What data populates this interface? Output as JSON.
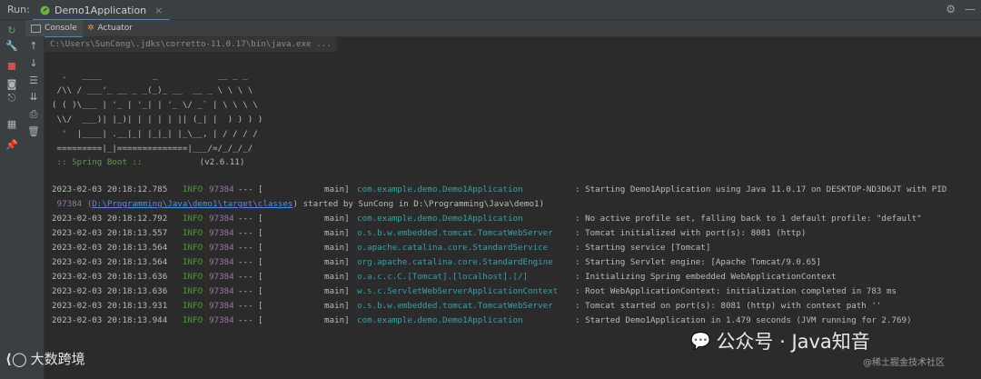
{
  "run": {
    "label": "Run:",
    "tab": "Demo1Application"
  },
  "subtabs": {
    "console": "Console",
    "actuator": "Actuator"
  },
  "command": "C:\\Users\\SunCong\\.jdks\\corretto-11.0.17\\bin\\java.exe ...",
  "banner": [
    "  .   ____          _            __ _ _",
    " /\\\\ / ___'_ __ _ _(_)_ __  __ _ \\ \\ \\ \\",
    "( ( )\\___ | '_ | '_| | '_ \\/ _` | \\ \\ \\ \\",
    " \\\\/  ___)| |_)| | | | | || (_| |  ) ) ) )",
    "  '  |____| .__|_| |_|_| |_\\__, | / / / /",
    " =========|_|==============|___/=/_/_/_/"
  ],
  "spring_boot": {
    "label": " :: Spring Boot ::",
    "version": "(v2.6.11)"
  },
  "log_lines": [
    {
      "ts": "2023-02-03 20:18:12.785",
      "level": "INFO",
      "pid": "97384",
      "sep": "--- [",
      "thread": "main]",
      "logger": "com.example.demo.Demo1Application",
      "message": ": Starting Demo1Application using Java 11.0.17 on DESKTOP-ND3D6JT with PID"
    },
    {
      "ts": "2023-02-03 20:18:12.792",
      "level": "INFO",
      "pid": "97384",
      "sep": "--- [",
      "thread": "main]",
      "logger": "com.example.demo.Demo1Application",
      "message": ": No active profile set, falling back to 1 default profile: \"default\""
    },
    {
      "ts": "2023-02-03 20:18:13.557",
      "level": "INFO",
      "pid": "97384",
      "sep": "--- [",
      "thread": "main]",
      "logger": "o.s.b.w.embedded.tomcat.TomcatWebServer",
      "message": ": Tomcat initialized with port(s): 8081 (http)"
    },
    {
      "ts": "2023-02-03 20:18:13.564",
      "level": "INFO",
      "pid": "97384",
      "sep": "--- [",
      "thread": "main]",
      "logger": "o.apache.catalina.core.StandardService",
      "message": ": Starting service [Tomcat]"
    },
    {
      "ts": "2023-02-03 20:18:13.564",
      "level": "INFO",
      "pid": "97384",
      "sep": "--- [",
      "thread": "main]",
      "logger": "org.apache.catalina.core.StandardEngine",
      "message": ": Starting Servlet engine: [Apache Tomcat/9.0.65]"
    },
    {
      "ts": "2023-02-03 20:18:13.636",
      "level": "INFO",
      "pid": "97384",
      "sep": "--- [",
      "thread": "main]",
      "logger": "o.a.c.c.C.[Tomcat].[localhost].[/]",
      "message": ": Initializing Spring embedded WebApplicationContext"
    },
    {
      "ts": "2023-02-03 20:18:13.636",
      "level": "INFO",
      "pid": "97384",
      "sep": "--- [",
      "thread": "main]",
      "logger": "w.s.c.ServletWebServerApplicationContext",
      "message": ": Root WebApplicationContext: initialization completed in 783 ms"
    },
    {
      "ts": "2023-02-03 20:18:13.931",
      "level": "INFO",
      "pid": "97384",
      "sep": "--- [",
      "thread": "main]",
      "logger": "o.s.b.w.embedded.tomcat.TomcatWebServer",
      "message": ": Tomcat started on port(s): 8081 (http) with context path ''"
    },
    {
      "ts": "2023-02-03 20:18:13.944",
      "level": "INFO",
      "pid": "97384",
      "sep": "--- [",
      "thread": "main]",
      "logger": "com.example.demo.Demo1Application",
      "message": ": Started Demo1Application in 1.479 seconds (JVM running for 2.769)"
    }
  ],
  "wrap_line": {
    "pid": " 97384 (",
    "path": "D:\\Programming\\Java\\demo1\\target\\classes",
    "rest": ") started by SunCong in D:\\Programming\\Java\\demo1)"
  },
  "watermarks": {
    "left": "大数跨境",
    "right": "公众号 · Java知音",
    "corner": "@稀土掘金技术社区"
  },
  "colors": {
    "accent": "#4a88c7",
    "info": "#4e9a38",
    "pid": "#9876aa",
    "logger": "#3b9fa6"
  }
}
